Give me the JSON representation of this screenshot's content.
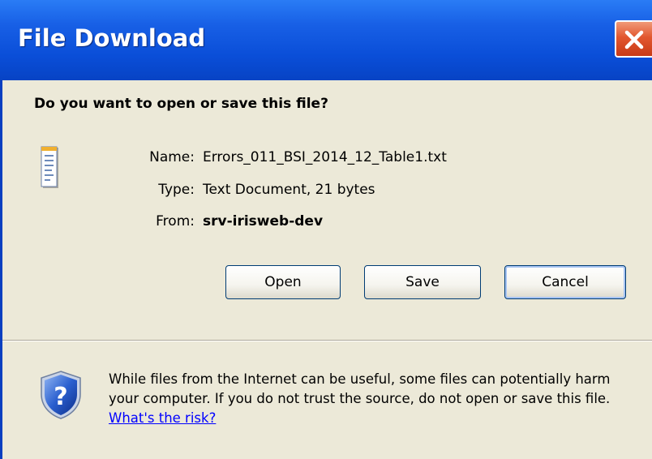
{
  "window": {
    "title": "File Download",
    "close_icon": "close-x-icon"
  },
  "prompt": {
    "question": "Do you want to open or save this file?"
  },
  "file": {
    "icon": "text-document-icon",
    "name_label": "Name:",
    "name_value": "Errors_011_BSI_2014_12_Table1.txt",
    "type_label": "Type:",
    "type_value": "Text Document, 21 bytes",
    "from_label": "From:",
    "from_value": "srv-irisweb-dev"
  },
  "buttons": {
    "open_label": "Open",
    "save_label": "Save",
    "cancel_label": "Cancel"
  },
  "security": {
    "icon": "shield-question-icon",
    "warning_text": "While files from the Internet can be useful, some files can potentially harm your computer. If you do not trust the source, do not open or save this file.",
    "link_text": "What's the risk?"
  },
  "colors": {
    "titlebar": "#0a4ed8",
    "close_button": "#e2572f",
    "dialog_background": "#ece9d8",
    "link": "#0000ff"
  }
}
